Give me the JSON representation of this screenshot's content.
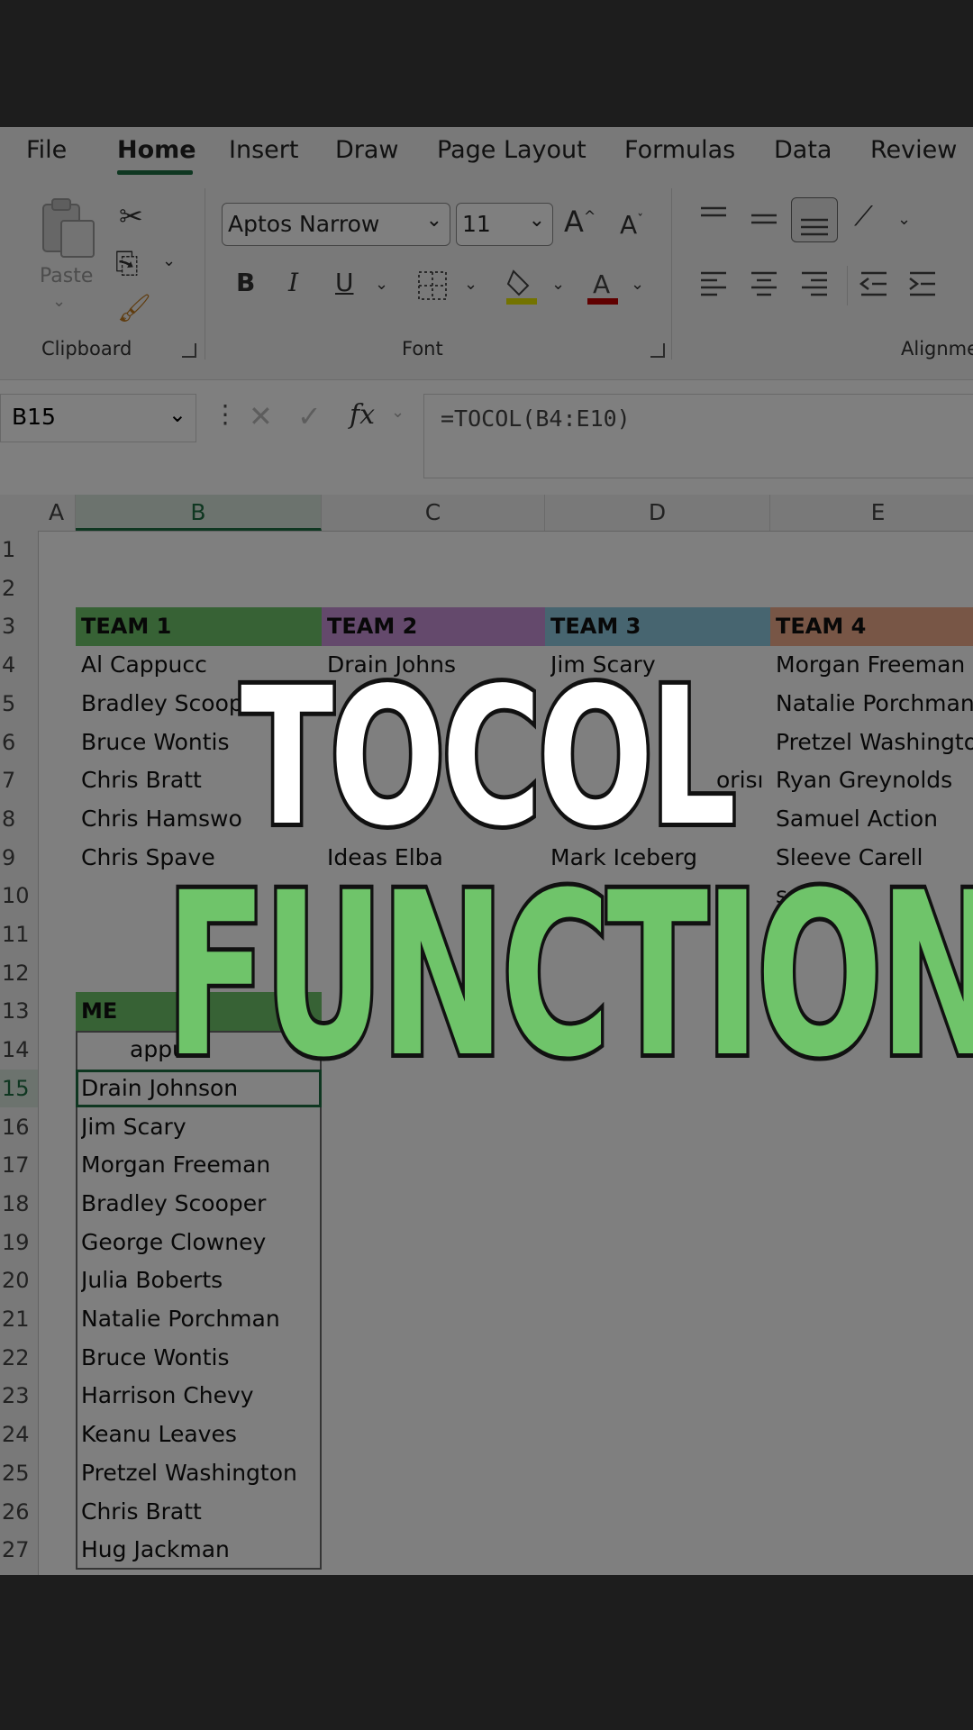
{
  "tabs": [
    "File",
    "Home",
    "Insert",
    "Draw",
    "Page Layout",
    "Formulas",
    "Data",
    "Review"
  ],
  "ribbon": {
    "paste_label": "Paste",
    "clipboard_label": "Clipboard",
    "font_label": "Font",
    "alignment_label": "Alignme",
    "font_name": "Aptos Narrow",
    "font_size": "11",
    "bold": "B",
    "italic": "I",
    "underline": "U"
  },
  "formula_bar": {
    "name_box": "B15",
    "fx": "fx",
    "formula": "=TOCOL(B4:E10)"
  },
  "columns": [
    "A",
    "B",
    "C",
    "D",
    "E"
  ],
  "rows": [
    "1",
    "2",
    "3",
    "4",
    "5",
    "6",
    "7",
    "8",
    "9",
    "10",
    "11",
    "12",
    "13",
    "14",
    "15",
    "16",
    "17",
    "18",
    "19",
    "20",
    "21",
    "22",
    "23",
    "24",
    "25",
    "26",
    "27"
  ],
  "teams": [
    {
      "label": "TEAM 1",
      "color": "#6fc46a"
    },
    {
      "label": "TEAM 2",
      "color": "#c893d9"
    },
    {
      "label": "TEAM 3",
      "color": "#8ecbe0"
    },
    {
      "label": "TEAM 4",
      "color": "#f0ad8c"
    }
  ],
  "team_table": {
    "col_b": [
      "Al Cappucc",
      "Bradley Scoop",
      "Bruce Wontis",
      "Chris Bratt",
      "Chris Hamswo",
      "Chris Spave"
    ],
    "col_c": [
      "Drain Johns",
      "",
      "",
      "",
      "",
      "Ideas Elba"
    ],
    "col_d": [
      "Jim Scary",
      "",
      "",
      "",
      "",
      "Mark Iceberg"
    ],
    "col_e": [
      "Morgan Freeman",
      "Natalie Porchman",
      "Pretzel Washington",
      "Ryan Greynolds",
      "Samuel Action",
      "Sleeve Carell",
      "s"
    ],
    "d7_fragment": "orisı"
  },
  "result_header": "ME",
  "row14_fragment": "appu",
  "result_list": [
    "Drain Johnson",
    "Jim Scary",
    "Morgan Freeman",
    "Bradley Scooper",
    "George Clowney",
    "Julia Boberts",
    "Natalie Porchman",
    "Bruce Wontis",
    "Harrison Chevy",
    "Keanu Leaves",
    "Pretzel Washington",
    "Chris Bratt",
    "Hug Jackman"
  ],
  "overlay": {
    "line1": "TOCOL",
    "line2": "FUNCTION"
  }
}
